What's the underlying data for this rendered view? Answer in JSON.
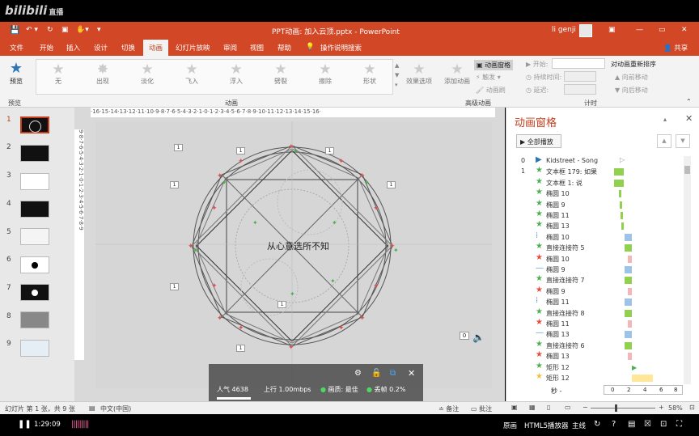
{
  "watermark": {
    "logo": "bilibili",
    "live": "直播"
  },
  "window": {
    "title": "PPT动画: 加入云顶.pptx  -  PowerPoint",
    "user": "li genji",
    "controls": [
      "—",
      "▭",
      "✕"
    ]
  },
  "tabs": [
    "文件",
    "开始",
    "插入",
    "设计",
    "切换",
    "动画",
    "幻灯片放映",
    "审阅",
    "视图",
    "帮助",
    "操作说明搜索"
  ],
  "share": "共享",
  "ribbon": {
    "preview": "预览",
    "effects": [
      "无",
      "出现",
      "淡化",
      "飞入",
      "浮入",
      "劈裂",
      "擦除",
      "形状"
    ],
    "effect_options": "效果选项",
    "add_animation": "添加动画",
    "anim_pane_btn": "动画窗格",
    "trigger": "触发",
    "anim_brush": "动画刷",
    "start_label": "开始:",
    "duration_label": "持续时间:",
    "delay_label": "延迟:",
    "reorder_title": "对动画重新排序",
    "move_earlier": "向前移动",
    "move_later": "向后移动",
    "groups": {
      "preview": "预览",
      "animation": "动画",
      "advanced": "高级动画",
      "timing": "计时"
    }
  },
  "ruler_h": "·16·15·14·13·12·11·10·9·8·7·6·5·4·3·2·1·0·1·2·3·4·5·6·7·8·9·10·11·12·13·14·15·16·",
  "ruler_v": "9·8·7·6·5·4·3·2·1·0·1·2·3·4·5·6·7·8·9",
  "slides": [
    "1",
    "2",
    "3",
    "4",
    "5",
    "6",
    "7",
    "8",
    "9"
  ],
  "slide_text": "从心意选所不知",
  "speaker_badge": "0",
  "tag_one": "1",
  "anim_pane": {
    "title": "动画窗格",
    "play_all": "全部播放",
    "items": [
      {
        "idx": "0",
        "icon": "▶",
        "name": "Kidstreet - Song",
        "color": "#2e75b6",
        "bar": "#ffffff"
      },
      {
        "idx": "1",
        "icon": "★",
        "name": "文本框 179: 如果",
        "color": "#4caf50",
        "bar": "#92d050"
      },
      {
        "idx": "",
        "icon": "★",
        "name": "文本框 1: 说",
        "color": "#4caf50",
        "bar": "#92d050"
      },
      {
        "idx": "",
        "icon": "★",
        "name": "椭圆 10",
        "color": "#4caf50",
        "bar": "#92d050"
      },
      {
        "idx": "",
        "icon": "★",
        "name": "椭圆 9",
        "color": "#4caf50",
        "bar": "#92d050"
      },
      {
        "idx": "",
        "icon": "★",
        "name": "椭圆 11",
        "color": "#4caf50",
        "bar": "#92d050"
      },
      {
        "idx": "",
        "icon": "★",
        "name": "椭圆 13",
        "color": "#4caf50",
        "bar": "#92d050"
      },
      {
        "idx": "",
        "icon": "⁞",
        "name": "椭圆 10",
        "color": "#5b9bd5",
        "bar": "#9dc3e6"
      },
      {
        "idx": "",
        "icon": "★",
        "name": "直接连接符 5",
        "color": "#4caf50",
        "bar": "#92d050"
      },
      {
        "idx": "",
        "icon": "★",
        "name": "椭圆 10",
        "color": "#e74c3c",
        "bar": "#f4b6b6"
      },
      {
        "idx": "",
        "icon": "—",
        "name": "椭圆 9",
        "color": "#5b9bd5",
        "bar": "#9dc3e6"
      },
      {
        "idx": "",
        "icon": "★",
        "name": "直接连接符 7",
        "color": "#4caf50",
        "bar": "#92d050"
      },
      {
        "idx": "",
        "icon": "★",
        "name": "椭圆 9",
        "color": "#e74c3c",
        "bar": "#f4b6b6"
      },
      {
        "idx": "",
        "icon": "⁞",
        "name": "椭圆 11",
        "color": "#5b9bd5",
        "bar": "#9dc3e6"
      },
      {
        "idx": "",
        "icon": "★",
        "name": "直接连接符 8",
        "color": "#4caf50",
        "bar": "#92d050"
      },
      {
        "idx": "",
        "icon": "★",
        "name": "椭圆 11",
        "color": "#e74c3c",
        "bar": "#f4b6b6"
      },
      {
        "idx": "",
        "icon": "—",
        "name": "椭圆 13",
        "color": "#5b9bd5",
        "bar": "#9dc3e6"
      },
      {
        "idx": "",
        "icon": "★",
        "name": "直接连接符 6",
        "color": "#4caf50",
        "bar": "#92d050"
      },
      {
        "idx": "",
        "icon": "★",
        "name": "椭圆 13",
        "color": "#e74c3c",
        "bar": "#f4b6b6"
      },
      {
        "idx": "",
        "icon": "★",
        "name": "矩形 12",
        "color": "#4caf50",
        "bar": "#92d050"
      },
      {
        "idx": "",
        "icon": "★",
        "name": "矩形 12",
        "color": "#f0c040",
        "bar": "#ffe699"
      }
    ],
    "seconds_label": "秒 -",
    "timeline": [
      "0",
      "2",
      "4",
      "6",
      "8"
    ]
  },
  "statusbar": {
    "slide_info": "幻灯片 第 1 张，共 9 张",
    "language": "中文(中国)",
    "notes": "备注",
    "comments": "批注",
    "zoom": "58%"
  },
  "stream_stats": {
    "popularity_label": "人气",
    "popularity": "4638",
    "upload_label": "上行",
    "upload": "1.00mbps",
    "quality_label": "画质:",
    "quality": "最佳",
    "drop_label": "丢帧",
    "drop": "0.2%"
  },
  "player": {
    "time": "1:29:09",
    "quality": "原画",
    "player_label": "HTML5播放器",
    "line": "主线"
  }
}
